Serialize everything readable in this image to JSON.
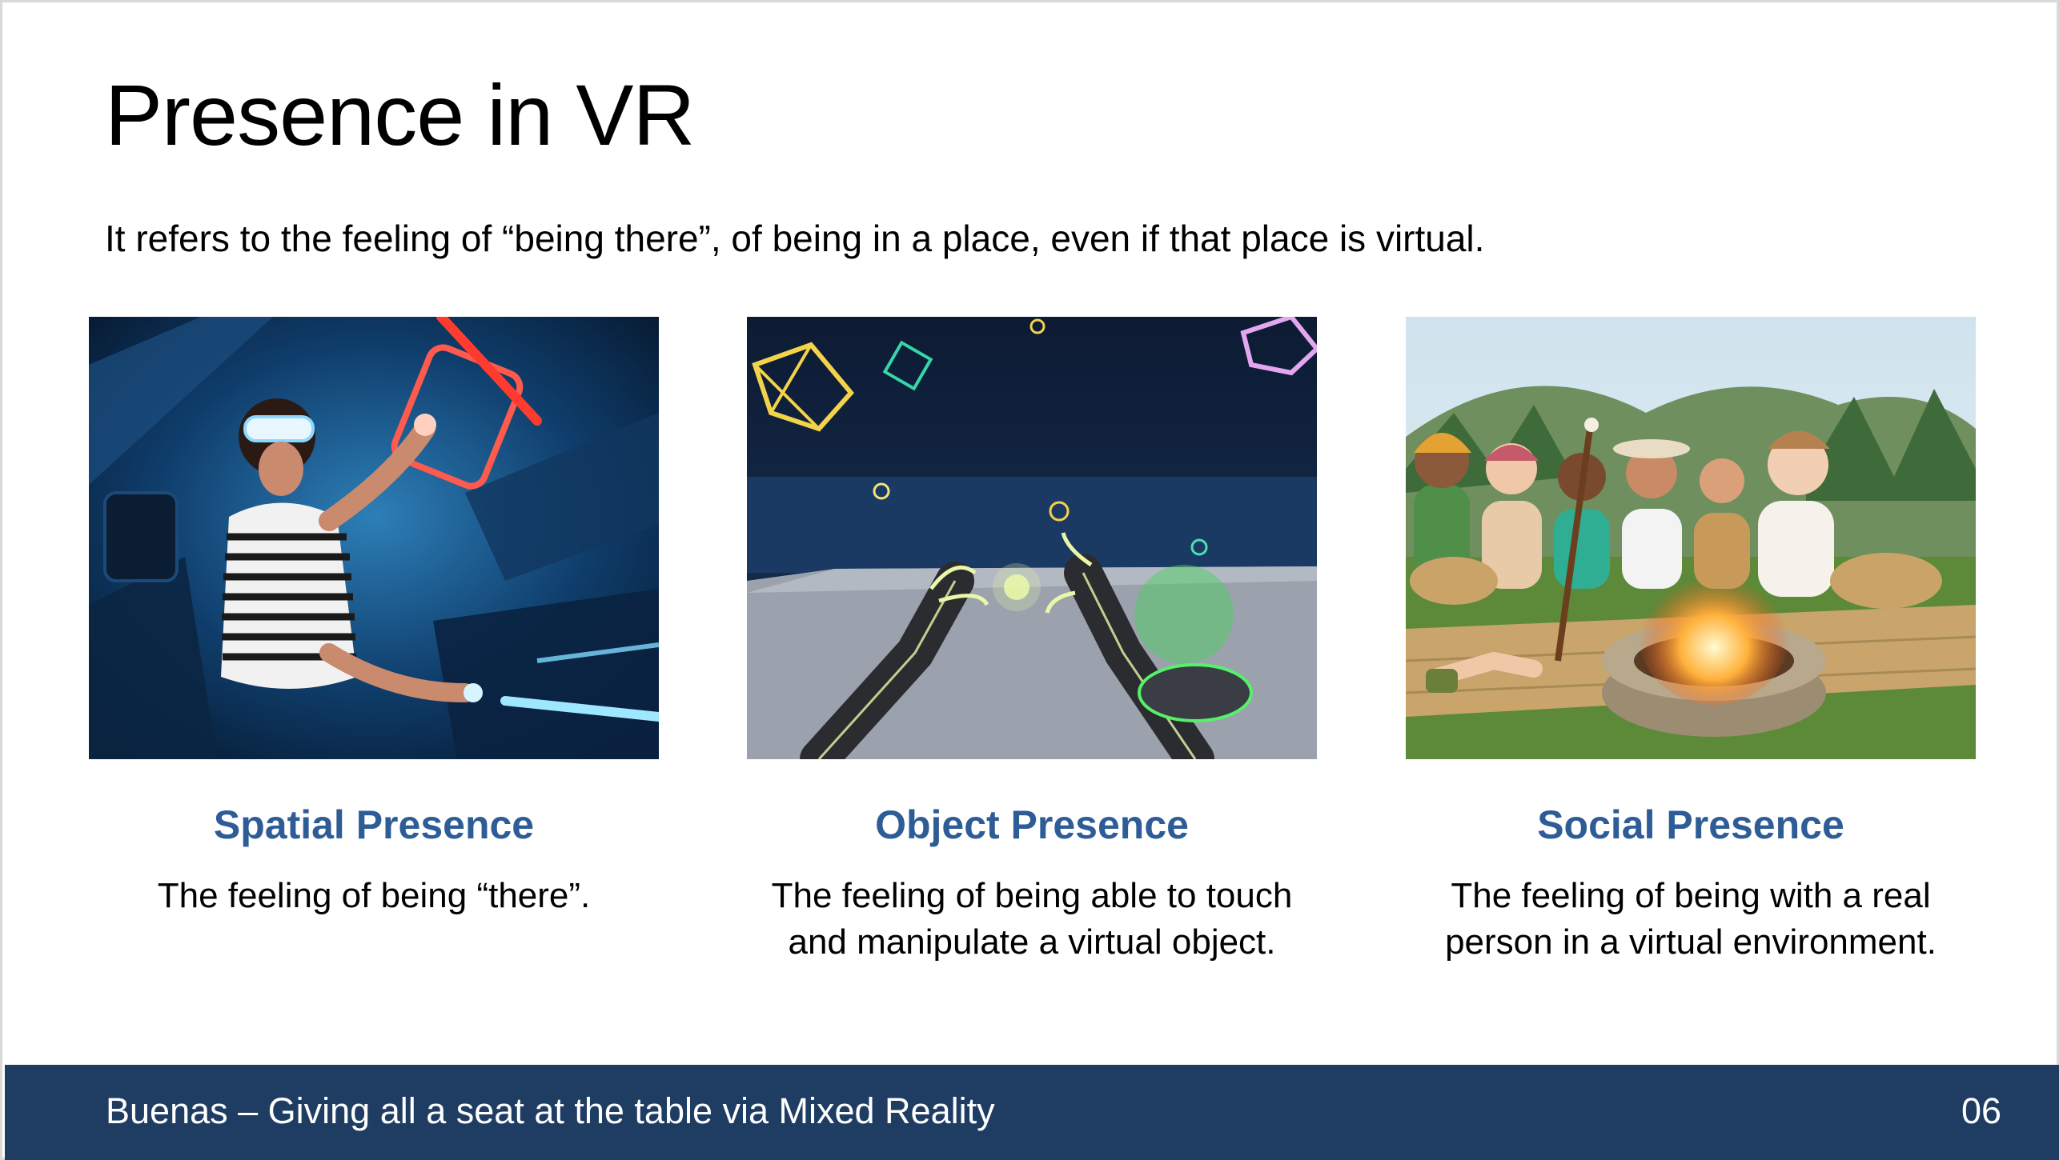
{
  "slide": {
    "title": "Presence in VR",
    "subtitle": "It refers to the feeling of “being there”, of being in a place, even if that place is virtual."
  },
  "cards": [
    {
      "image_subject": "vr-player-lightsabers",
      "heading": "Spatial Presence",
      "description": "The feeling of being “there”."
    },
    {
      "image_subject": "virtual-hands-objects",
      "heading": "Object Presence",
      "description": "The feeling of being able to touch and manipulate a virtual object."
    },
    {
      "image_subject": "avatars-campfire",
      "heading": "Social Presence",
      "description": "The feeling of being with a real person in a virtual environment."
    }
  ],
  "footer": {
    "caption": "Buenas – Giving all a seat at the table via Mixed Reality",
    "page_number": "06"
  },
  "colors": {
    "heading": "#2e5c96",
    "footer_bg": "#1f3d63"
  }
}
